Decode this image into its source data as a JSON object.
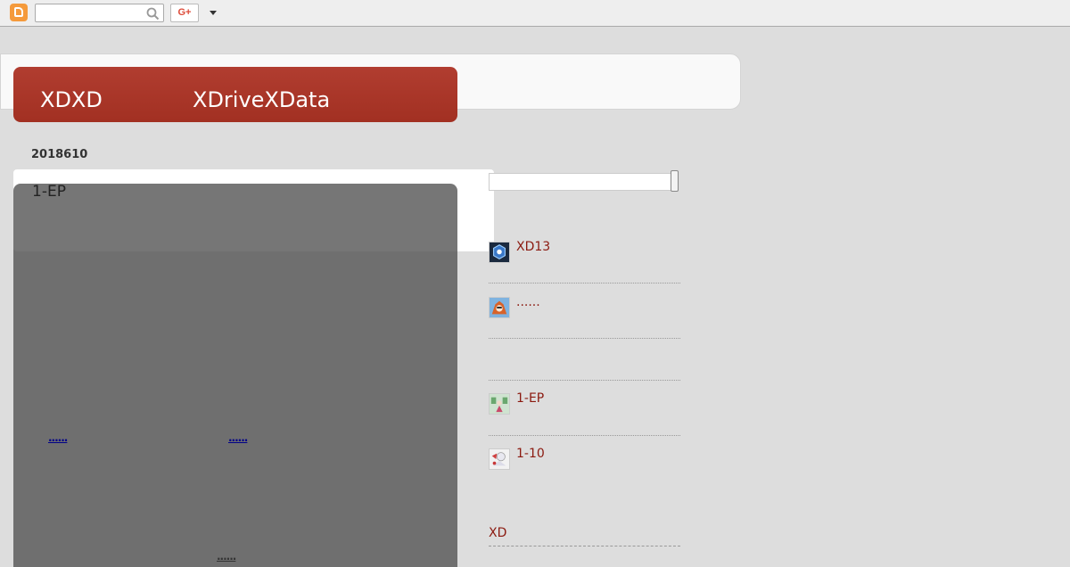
{
  "navbar": {
    "logo_icon": "blogger-icon",
    "search": {
      "value": "",
      "placeholder": ""
    },
    "search_icon": "search-icon",
    "gplus_label": "G+",
    "more_icon": "chevron-down-icon"
  },
  "header": {
    "title_left": "XDXD",
    "title_right": "XDriveXData",
    "accent_color": "#a8352a"
  },
  "post": {
    "date": "2018610",
    "title": "1-EP",
    "links": [
      "......",
      "......",
      "......"
    ]
  },
  "sidebar": {
    "search": {
      "value": "",
      "placeholder": ""
    },
    "items": [
      {
        "label": "XD13",
        "icon": "hexagon-thumb"
      },
      {
        "label": "......",
        "icon": "character-thumb"
      },
      {
        "label": "1-EP",
        "icon": "scene-thumb"
      },
      {
        "label": "1-10",
        "icon": "character-thumb-2"
      }
    ],
    "section_label": "XD"
  }
}
